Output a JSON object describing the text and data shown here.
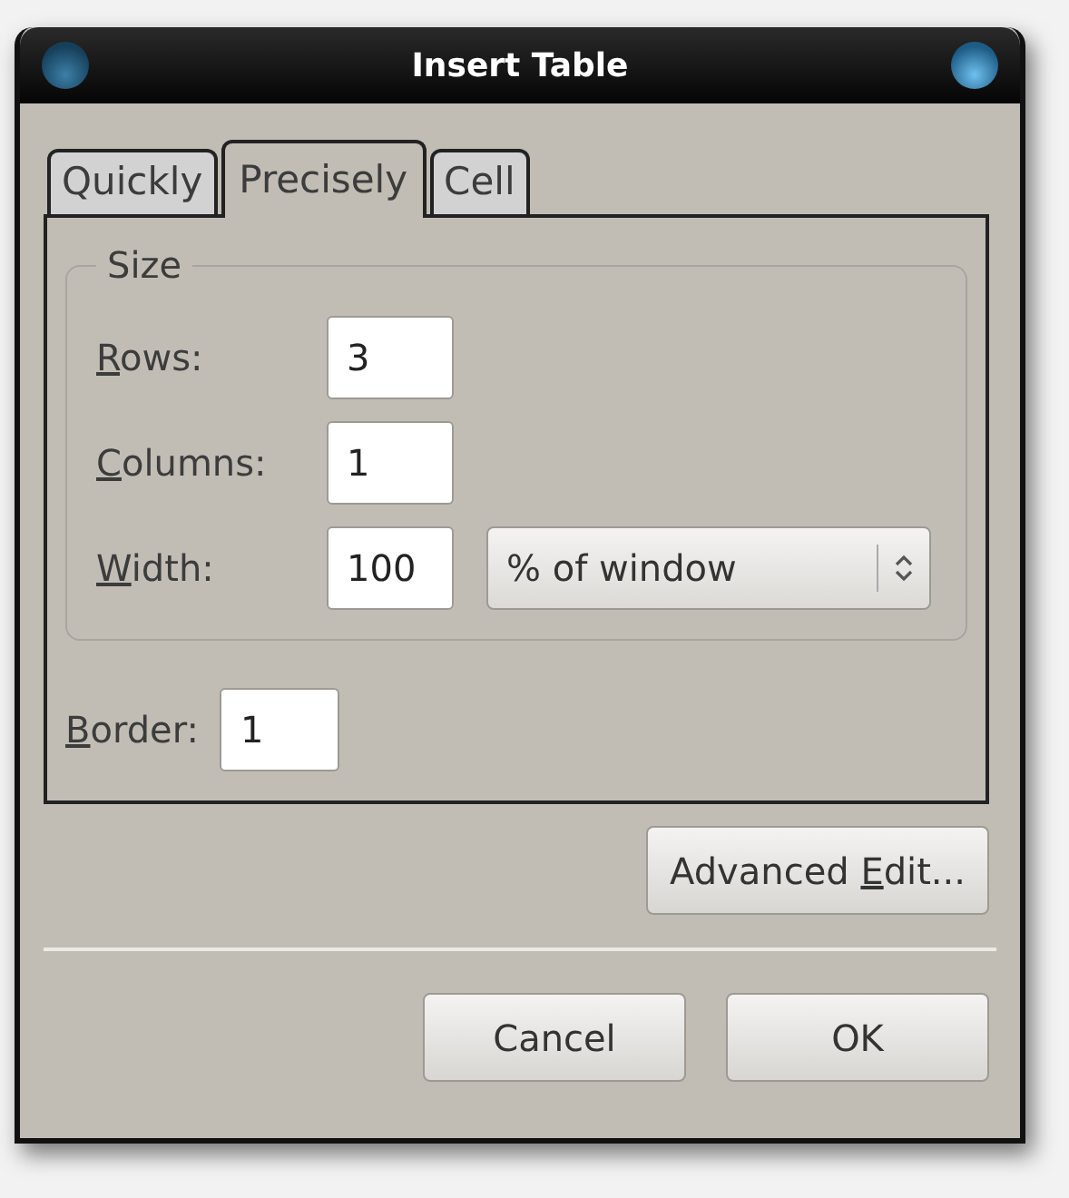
{
  "window": {
    "title": "Insert Table"
  },
  "tabs": [
    {
      "label": "Quickly",
      "selected": false
    },
    {
      "label": "Precisely",
      "selected": true
    },
    {
      "label": "Cell",
      "selected": false
    }
  ],
  "size_group": {
    "title": "Size",
    "fields": [
      {
        "label": {
          "access_key": "R",
          "after": "ows:"
        },
        "value": "3"
      },
      {
        "label": {
          "access_key": "C",
          "after": "olumns:"
        },
        "value": "1"
      },
      {
        "label": {
          "access_key": "W",
          "after": "idth:"
        },
        "value": "100",
        "unit": "% of window"
      }
    ]
  },
  "border": {
    "label": {
      "access_key": "B",
      "after": "order:"
    },
    "value": "1"
  },
  "advanced_button": {
    "label": {
      "before": "Advanced ",
      "access_key": "E",
      "after": "dit..."
    }
  },
  "buttons": [
    {
      "label": "Cancel"
    },
    {
      "label": "OK"
    }
  ]
}
